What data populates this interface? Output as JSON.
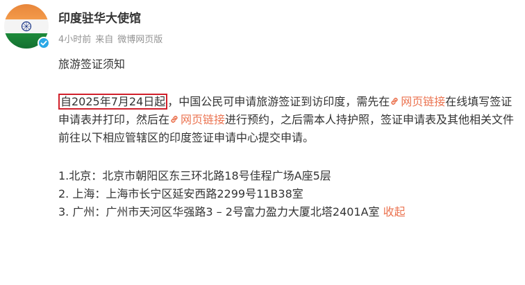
{
  "account": {
    "name": "印度驻华大使馆",
    "time": "4小时前",
    "source_prefix": "来自",
    "source": "微博网页版"
  },
  "post": {
    "title": "旅游签证须知",
    "highlight": "自2025年7月24日起",
    "seg1": "，中国公民可申请旅游签证到访印度，需先在",
    "link1": "网页链接",
    "seg2": "在线填写签证申请表并打印，然后在",
    "link2": "网页链接",
    "seg3": "进行预约，之后需本人持护照，签证申请表及其他相关文件前往以下相应管辖区的印度签证申请中心提交申请。",
    "addresses": [
      "1.北京：北京市朝阳区东三环北路18号佳程广场A座5层",
      "2. 上海：上海市长宁区延安西路2299号11B38室",
      "3. 广州：广州市天河区华强路3 – 2号富力盈力大厦北塔2401A室"
    ],
    "collapse": "收起"
  },
  "colors": {
    "link": "#eb7350",
    "highlight_border": "#d01f2a",
    "verified": "#2aa8e6"
  },
  "icons": [
    "indian-flag-avatar",
    "verified-icon",
    "link-icon"
  ]
}
